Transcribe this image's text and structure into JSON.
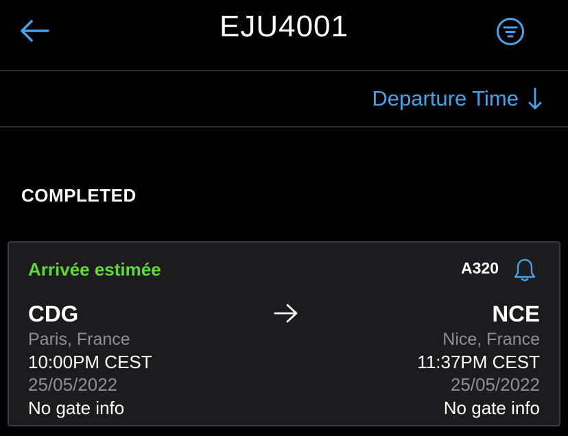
{
  "header": {
    "title": "EJU4001",
    "back_icon": "arrow-left-icon",
    "filter_icon": "filter-list-icon"
  },
  "sort": {
    "label": "Departure Time",
    "direction_icon": "arrow-down-icon"
  },
  "section": {
    "label": "COMPLETED"
  },
  "flight_card": {
    "status": "Arrivée estimée",
    "aircraft": "A320",
    "alert_icon": "bell-icon",
    "route_icon": "arrow-right-icon",
    "origin": {
      "code": "CDG",
      "city": "Paris, France",
      "time": "10:00PM CEST",
      "date": "25/05/2022",
      "gate": "No gate info"
    },
    "destination": {
      "code": "NCE",
      "city": "Nice, France",
      "time": "11:37PM CEST",
      "date": "25/05/2022",
      "gate": "No gate info"
    }
  },
  "colors": {
    "background": "#000000",
    "accent": "#4aa3e8",
    "status_green": "#5fd83a",
    "card_bg": "#1c1c1e",
    "muted_text": "#8e8e93"
  }
}
